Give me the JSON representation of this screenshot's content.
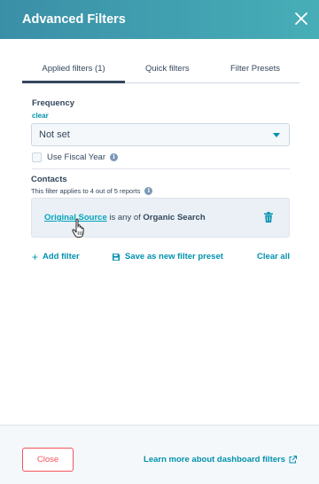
{
  "header": {
    "title": "Advanced Filters"
  },
  "tabs": [
    {
      "label": "Applied filters (1)",
      "active": true
    },
    {
      "label": "Quick filters",
      "active": false
    },
    {
      "label": "Filter Presets",
      "active": false
    }
  ],
  "frequency": {
    "label": "Frequency",
    "clear_label": "clear",
    "selected": "Not set",
    "use_fiscal_year_label": "Use Fiscal Year",
    "use_fiscal_year_checked": false
  },
  "contacts": {
    "label": "Contacts",
    "note": "This filter applies to 4 out of 5 reports",
    "filter": {
      "property": "Original Source",
      "operator": "is any of",
      "value": "Organic Search"
    }
  },
  "actions": {
    "add_filter": "Add filter",
    "save_preset": "Save as new filter preset",
    "clear_all": "Clear all"
  },
  "footer": {
    "close_label": "Close",
    "learn_more": "Learn more about dashboard filters"
  },
  "icons": {
    "close": "close-icon",
    "caret": "chevron-down-icon",
    "info": "info-icon",
    "trash": "trash-icon",
    "plus": "plus-icon",
    "save": "floppy-disk-icon",
    "external": "external-link-icon",
    "cursor": "hand-pointer-icon"
  },
  "colors": {
    "header_start": "#3a8fa7",
    "header_end": "#47aeb7",
    "link": "#0091ae",
    "property_link": "#00a4bd",
    "text": "#33475b",
    "danger": "#f2545b",
    "card_bg": "#eaf0f6"
  }
}
